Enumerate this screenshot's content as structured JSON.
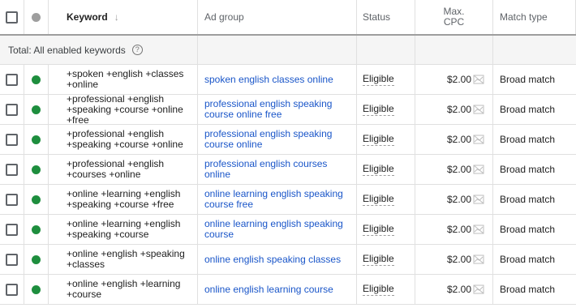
{
  "header": {
    "keyword": "Keyword",
    "sort_arrow": "↓",
    "ad_group": "Ad group",
    "status": "Status",
    "max_cpc_line1": "Max.",
    "max_cpc_line2": "CPC",
    "match_type": "Match type"
  },
  "total": {
    "label": "Total: All enabled keywords",
    "help": "?"
  },
  "rows": [
    {
      "keyword": "+spoken +english +classes +online",
      "ad_group": "spoken english classes online",
      "status": "Eligible",
      "cpc": "$2.00",
      "match": "Broad match"
    },
    {
      "keyword": "+professional +english +speaking +course +online +free",
      "ad_group": "professional english speaking course online free",
      "status": "Eligible",
      "cpc": "$2.00",
      "match": "Broad match"
    },
    {
      "keyword": "+professional +english +speaking +course +online",
      "ad_group": "professional english speaking course online",
      "status": "Eligible",
      "cpc": "$2.00",
      "match": "Broad match"
    },
    {
      "keyword": "+professional +english +courses +online",
      "ad_group": "professional english courses online",
      "status": "Eligible",
      "cpc": "$2.00",
      "match": "Broad match"
    },
    {
      "keyword": "+online +learning +english +speaking +course +free",
      "ad_group": "online learning english speaking course free",
      "status": "Eligible",
      "cpc": "$2.00",
      "match": "Broad match"
    },
    {
      "keyword": "+online +learning +english +speaking +course",
      "ad_group": "online learning english speaking course",
      "status": "Eligible",
      "cpc": "$2.00",
      "match": "Broad match"
    },
    {
      "keyword": "+online +english +speaking +classes",
      "ad_group": "online english speaking classes",
      "status": "Eligible",
      "cpc": "$2.00",
      "match": "Broad match"
    },
    {
      "keyword": "+online +english +learning +course",
      "ad_group": "online english learning course",
      "status": "Eligible",
      "cpc": "$2.00",
      "match": "Broad match"
    }
  ],
  "colors": {
    "enabled_dot": "#1e8e3e",
    "link": "#1a56c9"
  },
  "icons": {
    "row_status": "enabled-dot-icon",
    "cpc": "bid-simulator-chart-icon"
  }
}
